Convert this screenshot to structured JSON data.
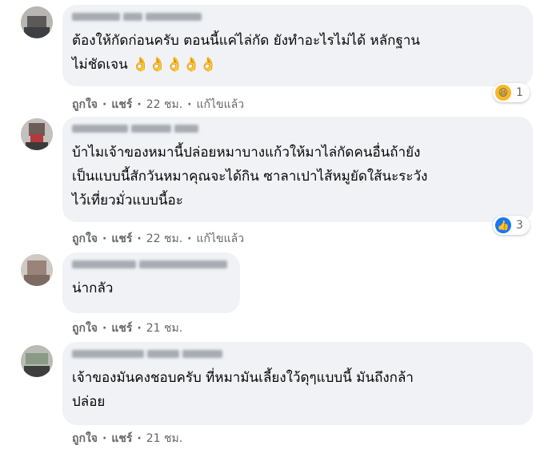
{
  "comments": [
    {
      "text": "ต้องให้กัดก่อนครับ ตอนนี้แค่ไล่กัด ยังทำอะไรไม่ได้ หลักฐาน\nไม่ชัดเจน",
      "emoji": "👌👌👌👌👌",
      "reaction": {
        "icon": "haha-icon",
        "count": "1"
      },
      "actions": {
        "like": "ถูกใจ",
        "reply": "แชร์",
        "time": "22 ชม.",
        "edited": "แก้ไขแล้ว"
      }
    },
    {
      "text": "บ้าไมเจ้าของหมานี้ปล่อยหมาบางแก้วให้มาไล่กัดคนอื่นถ้ายัง\nเป็นแบบนี้สักวันหมาคุณจะได้กิน ซาลาเปาไส้หมูยัดใส้นะระวัง\nไว้เที่ยวมั่วแบบนี้อะ",
      "reaction": {
        "icon": "like-icon",
        "count": "3"
      },
      "actions": {
        "like": "ถูกใจ",
        "reply": "แชร์",
        "time": "22 ชม.",
        "edited": "แก้ไขแล้ว"
      }
    },
    {
      "text": "น่ากลัว",
      "actions": {
        "like": "ถูกใจ",
        "reply": "แชร์",
        "time": "21 ชม."
      }
    },
    {
      "text": "เจ้าของมันคงชอบครับ ที่หมามันเลี้ยงใว้ดุๆแบบนี้ มันถึงกล้า\nปล่อย",
      "actions": {
        "like": "ถูกใจ",
        "reply": "แชร์",
        "time": "21 ชม."
      }
    }
  ],
  "colors": {
    "bubble": "#f0f2f5",
    "meta_text": "#65676b",
    "like_blue": "#1877f2",
    "haha_yellow": "#f7b928"
  }
}
